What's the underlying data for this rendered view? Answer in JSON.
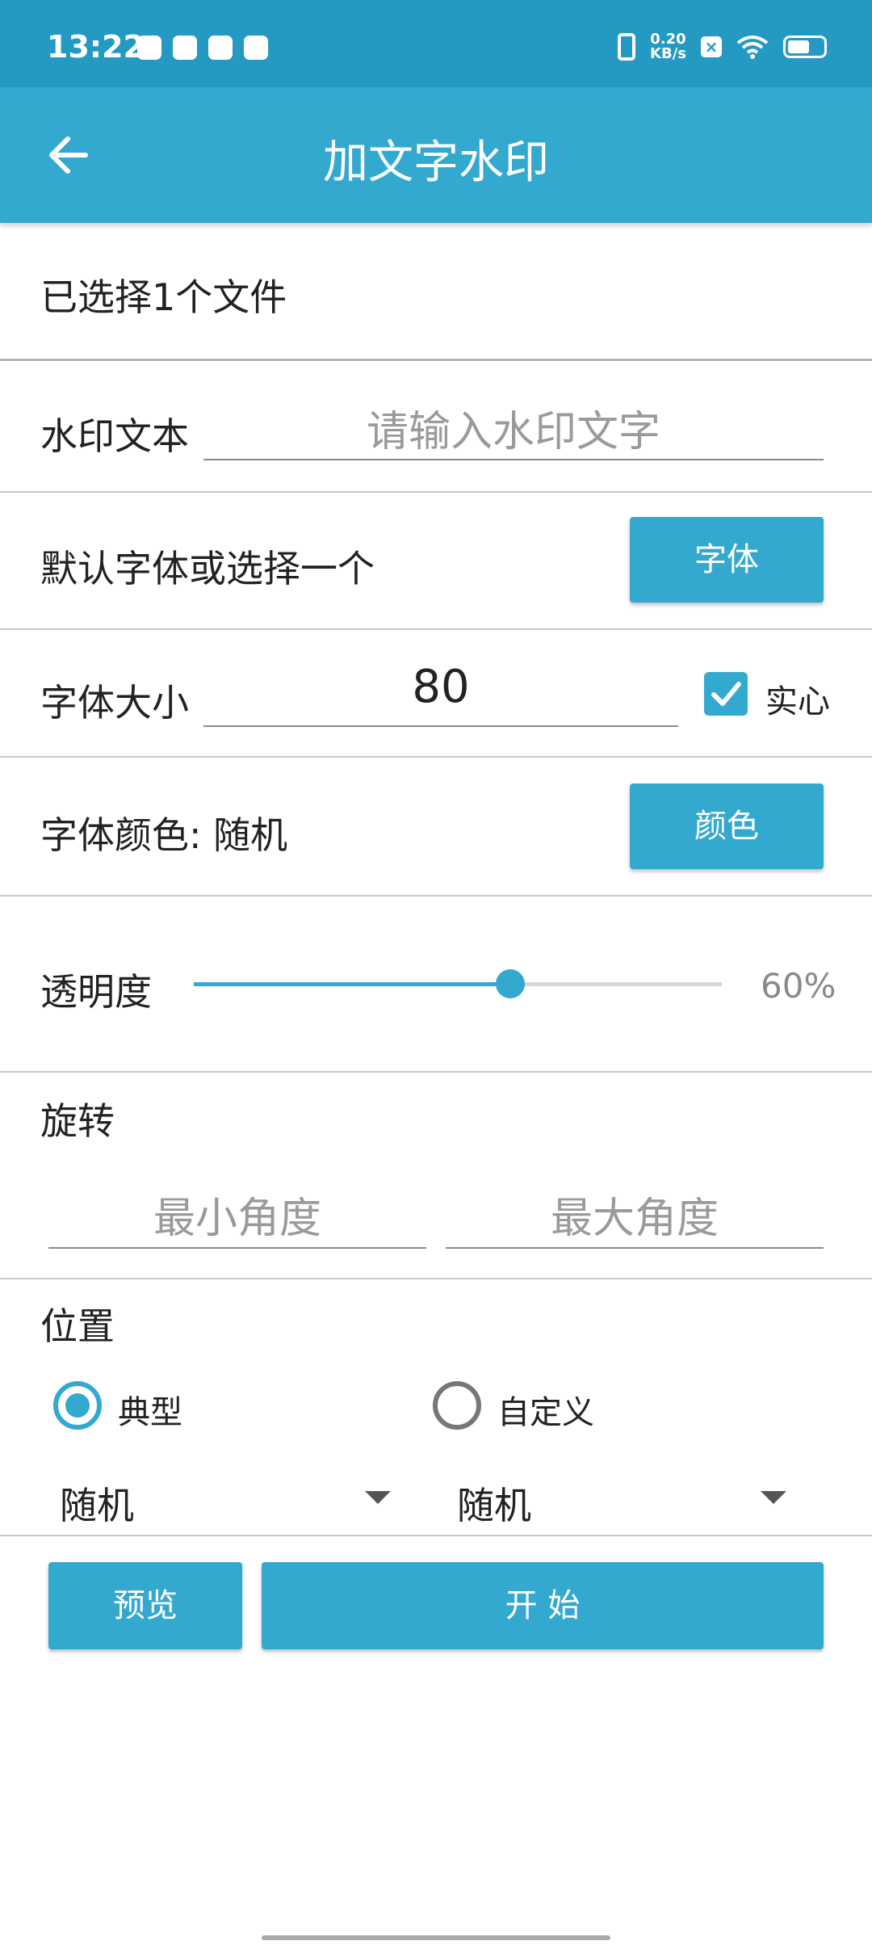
{
  "status_bar": {
    "time": "13:22",
    "network_speed_value": "0.20",
    "network_speed_unit": "KB/s",
    "battery_icon": "battery-icon",
    "wifi_icon": "wifi-icon"
  },
  "app_bar": {
    "title": "加文字水印",
    "back_icon": "arrow-left-icon"
  },
  "selected_files": "已选择1个文件",
  "watermark_text": {
    "label": "水印文本",
    "placeholder": "请输入水印文字",
    "value": ""
  },
  "font": {
    "label": "默认字体或选择一个",
    "button": "字体"
  },
  "font_size": {
    "label": "字体大小",
    "value": "80",
    "solid_label": "实心",
    "solid_checked": true
  },
  "font_color": {
    "label": "字体颜色: 随机",
    "button": "颜色"
  },
  "opacity": {
    "label": "透明度",
    "value_text": "60%",
    "fraction": 0.6
  },
  "rotation": {
    "label": "旋转",
    "min_placeholder": "最小角度",
    "max_placeholder": "最大角度"
  },
  "position": {
    "label": "位置",
    "option_typical": "典型",
    "option_custom": "自定义",
    "selected": "典型",
    "dropdown_left": "随机",
    "dropdown_right": "随机"
  },
  "actions": {
    "preview": "预览",
    "start": "开 始"
  },
  "colors": {
    "status_bar": "#2499c2",
    "accent": "#34a9d0"
  }
}
